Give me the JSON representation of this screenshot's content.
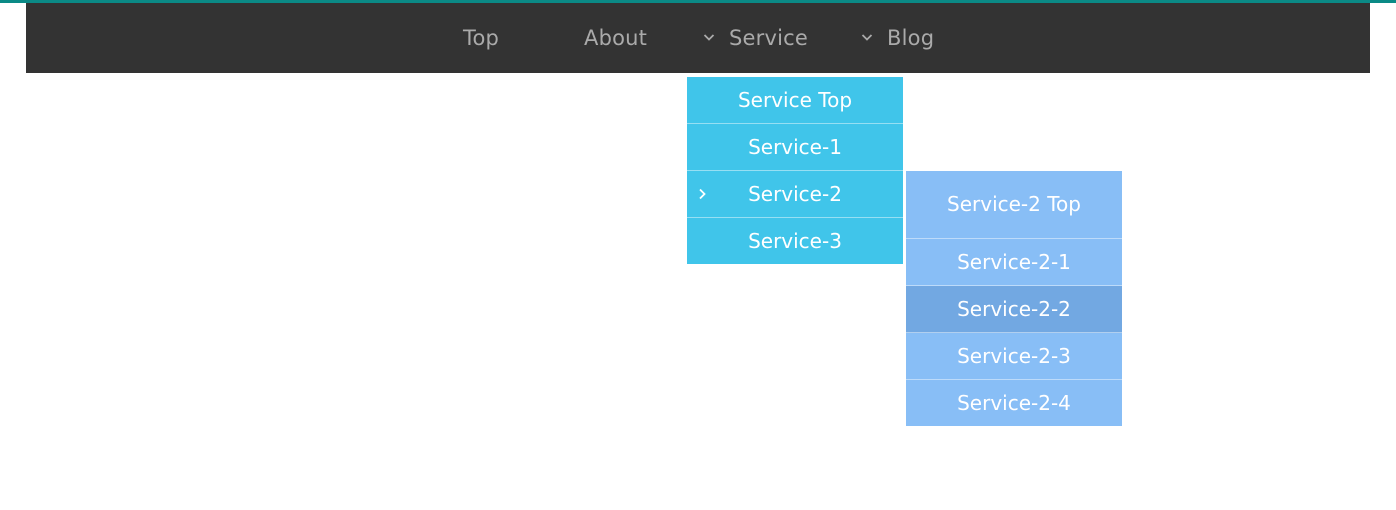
{
  "colors": {
    "accent_bar": "#0b8a86",
    "navbar_bg": "#333333",
    "nav_text": "#aaaaaa",
    "submenu_bg": "#40c5ea",
    "nested_submenu_bg": "#88bef6",
    "nested_submenu_hover": "#72a8e2"
  },
  "nav": {
    "items": [
      {
        "label": "Top"
      },
      {
        "label": "About"
      },
      {
        "label": "Service",
        "icon": "chevron-down-icon"
      },
      {
        "label": "Blog",
        "icon": "chevron-down-icon"
      }
    ]
  },
  "service_menu": {
    "items": [
      {
        "label": "Service Top"
      },
      {
        "label": "Service-1"
      },
      {
        "label": "Service-2",
        "icon": "chevron-right-icon"
      },
      {
        "label": "Service-3"
      }
    ]
  },
  "service2_menu": {
    "items": [
      {
        "label": "Service-2 Top"
      },
      {
        "label": "Service-2-1"
      },
      {
        "label": "Service-2-2",
        "state": "hovered"
      },
      {
        "label": "Service-2-3"
      },
      {
        "label": "Service-2-4"
      }
    ]
  }
}
